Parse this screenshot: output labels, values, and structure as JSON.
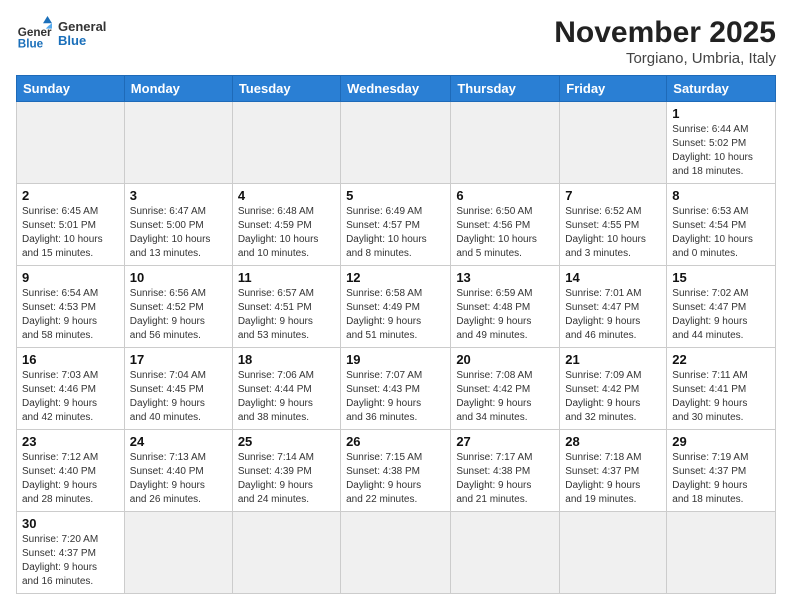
{
  "header": {
    "logo_general": "General",
    "logo_blue": "Blue",
    "month": "November 2025",
    "location": "Torgiano, Umbria, Italy"
  },
  "days_of_week": [
    "Sunday",
    "Monday",
    "Tuesday",
    "Wednesday",
    "Thursday",
    "Friday",
    "Saturday"
  ],
  "weeks": [
    [
      {
        "num": "",
        "info": ""
      },
      {
        "num": "",
        "info": ""
      },
      {
        "num": "",
        "info": ""
      },
      {
        "num": "",
        "info": ""
      },
      {
        "num": "",
        "info": ""
      },
      {
        "num": "",
        "info": ""
      },
      {
        "num": "1",
        "info": "Sunrise: 6:44 AM\nSunset: 5:02 PM\nDaylight: 10 hours\nand 18 minutes."
      }
    ],
    [
      {
        "num": "2",
        "info": "Sunrise: 6:45 AM\nSunset: 5:01 PM\nDaylight: 10 hours\nand 15 minutes."
      },
      {
        "num": "3",
        "info": "Sunrise: 6:47 AM\nSunset: 5:00 PM\nDaylight: 10 hours\nand 13 minutes."
      },
      {
        "num": "4",
        "info": "Sunrise: 6:48 AM\nSunset: 4:59 PM\nDaylight: 10 hours\nand 10 minutes."
      },
      {
        "num": "5",
        "info": "Sunrise: 6:49 AM\nSunset: 4:57 PM\nDaylight: 10 hours\nand 8 minutes."
      },
      {
        "num": "6",
        "info": "Sunrise: 6:50 AM\nSunset: 4:56 PM\nDaylight: 10 hours\nand 5 minutes."
      },
      {
        "num": "7",
        "info": "Sunrise: 6:52 AM\nSunset: 4:55 PM\nDaylight: 10 hours\nand 3 minutes."
      },
      {
        "num": "8",
        "info": "Sunrise: 6:53 AM\nSunset: 4:54 PM\nDaylight: 10 hours\nand 0 minutes."
      }
    ],
    [
      {
        "num": "9",
        "info": "Sunrise: 6:54 AM\nSunset: 4:53 PM\nDaylight: 9 hours\nand 58 minutes."
      },
      {
        "num": "10",
        "info": "Sunrise: 6:56 AM\nSunset: 4:52 PM\nDaylight: 9 hours\nand 56 minutes."
      },
      {
        "num": "11",
        "info": "Sunrise: 6:57 AM\nSunset: 4:51 PM\nDaylight: 9 hours\nand 53 minutes."
      },
      {
        "num": "12",
        "info": "Sunrise: 6:58 AM\nSunset: 4:49 PM\nDaylight: 9 hours\nand 51 minutes."
      },
      {
        "num": "13",
        "info": "Sunrise: 6:59 AM\nSunset: 4:48 PM\nDaylight: 9 hours\nand 49 minutes."
      },
      {
        "num": "14",
        "info": "Sunrise: 7:01 AM\nSunset: 4:47 PM\nDaylight: 9 hours\nand 46 minutes."
      },
      {
        "num": "15",
        "info": "Sunrise: 7:02 AM\nSunset: 4:47 PM\nDaylight: 9 hours\nand 44 minutes."
      }
    ],
    [
      {
        "num": "16",
        "info": "Sunrise: 7:03 AM\nSunset: 4:46 PM\nDaylight: 9 hours\nand 42 minutes."
      },
      {
        "num": "17",
        "info": "Sunrise: 7:04 AM\nSunset: 4:45 PM\nDaylight: 9 hours\nand 40 minutes."
      },
      {
        "num": "18",
        "info": "Sunrise: 7:06 AM\nSunset: 4:44 PM\nDaylight: 9 hours\nand 38 minutes."
      },
      {
        "num": "19",
        "info": "Sunrise: 7:07 AM\nSunset: 4:43 PM\nDaylight: 9 hours\nand 36 minutes."
      },
      {
        "num": "20",
        "info": "Sunrise: 7:08 AM\nSunset: 4:42 PM\nDaylight: 9 hours\nand 34 minutes."
      },
      {
        "num": "21",
        "info": "Sunrise: 7:09 AM\nSunset: 4:42 PM\nDaylight: 9 hours\nand 32 minutes."
      },
      {
        "num": "22",
        "info": "Sunrise: 7:11 AM\nSunset: 4:41 PM\nDaylight: 9 hours\nand 30 minutes."
      }
    ],
    [
      {
        "num": "23",
        "info": "Sunrise: 7:12 AM\nSunset: 4:40 PM\nDaylight: 9 hours\nand 28 minutes."
      },
      {
        "num": "24",
        "info": "Sunrise: 7:13 AM\nSunset: 4:40 PM\nDaylight: 9 hours\nand 26 minutes."
      },
      {
        "num": "25",
        "info": "Sunrise: 7:14 AM\nSunset: 4:39 PM\nDaylight: 9 hours\nand 24 minutes."
      },
      {
        "num": "26",
        "info": "Sunrise: 7:15 AM\nSunset: 4:38 PM\nDaylight: 9 hours\nand 22 minutes."
      },
      {
        "num": "27",
        "info": "Sunrise: 7:17 AM\nSunset: 4:38 PM\nDaylight: 9 hours\nand 21 minutes."
      },
      {
        "num": "28",
        "info": "Sunrise: 7:18 AM\nSunset: 4:37 PM\nDaylight: 9 hours\nand 19 minutes."
      },
      {
        "num": "29",
        "info": "Sunrise: 7:19 AM\nSunset: 4:37 PM\nDaylight: 9 hours\nand 18 minutes."
      }
    ],
    [
      {
        "num": "30",
        "info": "Sunrise: 7:20 AM\nSunset: 4:37 PM\nDaylight: 9 hours\nand 16 minutes."
      },
      {
        "num": "",
        "info": ""
      },
      {
        "num": "",
        "info": ""
      },
      {
        "num": "",
        "info": ""
      },
      {
        "num": "",
        "info": ""
      },
      {
        "num": "",
        "info": ""
      },
      {
        "num": "",
        "info": ""
      }
    ]
  ]
}
